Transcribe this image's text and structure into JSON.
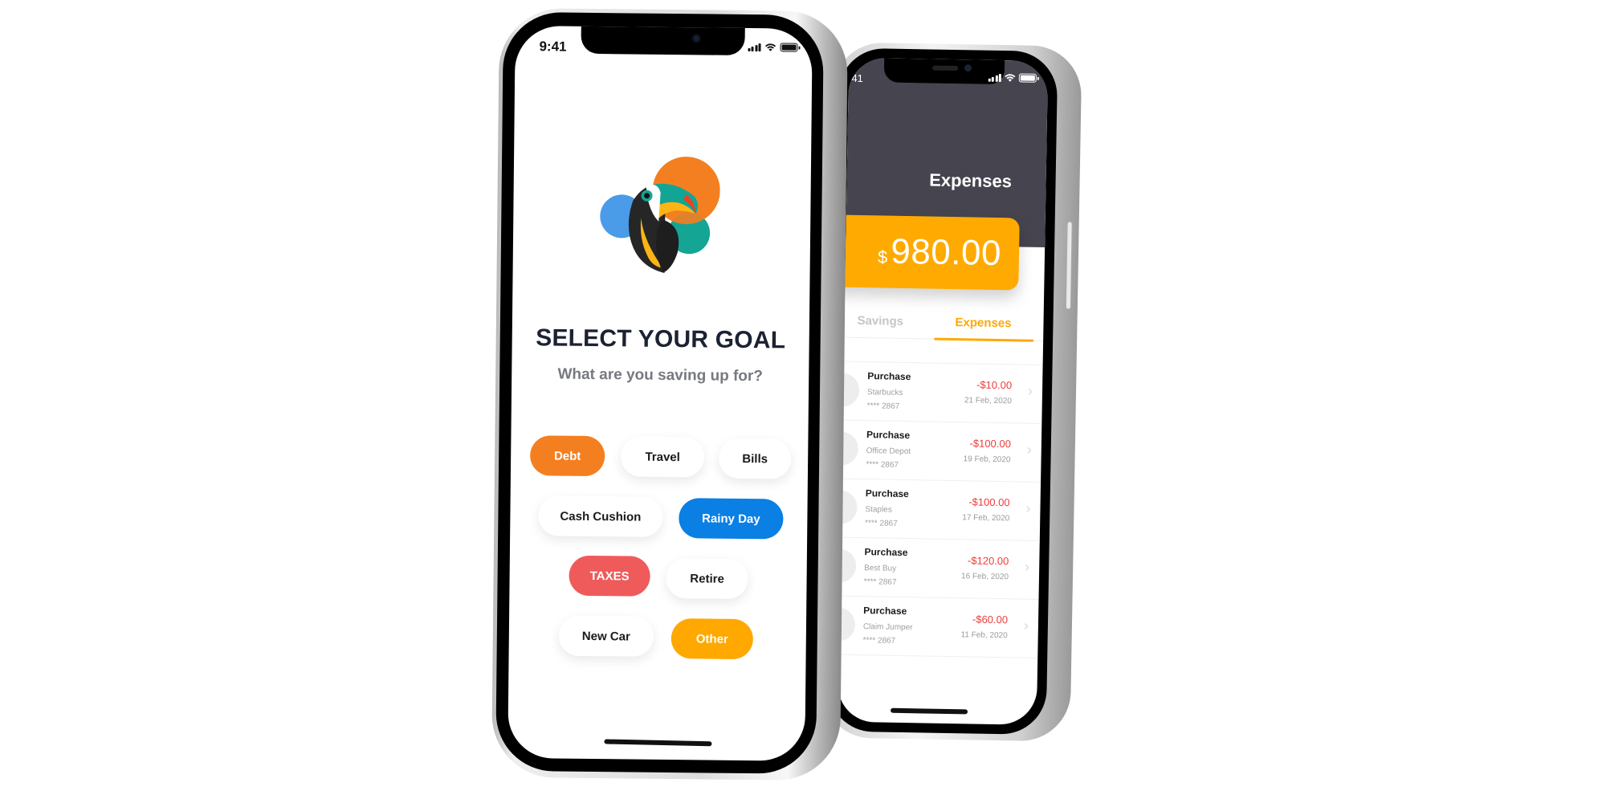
{
  "front_phone": {
    "status_bar": {
      "time": "9:41",
      "icons": [
        "signal-icon",
        "wifi-icon",
        "battery-icon"
      ]
    },
    "logo": "toucan-logo",
    "title": "SELECT YOUR GOAL",
    "subtitle": "What are you saving up for?",
    "goals": [
      {
        "label": "Debt",
        "selected": true,
        "color": "#f47f20"
      },
      {
        "label": "Travel",
        "selected": false
      },
      {
        "label": "Bills",
        "selected": false
      },
      {
        "label": "Cash Cushion",
        "selected": false
      },
      {
        "label": "Rainy Day",
        "selected": true,
        "color": "#0a7fe4"
      },
      {
        "label": "TAXES",
        "selected": true,
        "color": "#ef5b5b"
      },
      {
        "label": "Retire",
        "selected": false
      },
      {
        "label": "New Car",
        "selected": false
      },
      {
        "label": "Other",
        "selected": true,
        "color": "#ffa800"
      }
    ]
  },
  "back_phone": {
    "status_bar": {
      "time": ":41",
      "icons": [
        "signal-icon",
        "wifi-icon",
        "battery-icon"
      ]
    },
    "title": "Expenses",
    "balance": {
      "currency": "$",
      "amount": "980.00"
    },
    "tabs": [
      {
        "label": "Savings",
        "active": false
      },
      {
        "label": "Expenses",
        "active": true
      }
    ],
    "transactions": [
      {
        "type": "Purchase",
        "merchant": "Starbucks",
        "card": "**** 2867",
        "amount": "-$10.00",
        "date": "21 Feb, 2020"
      },
      {
        "type": "Purchase",
        "merchant": "Office Depot",
        "card": "**** 2867",
        "amount": "-$100.00",
        "date": "19 Feb, 2020"
      },
      {
        "type": "Purchase",
        "merchant": "Staples",
        "card": "**** 2867",
        "amount": "-$100.00",
        "date": "17 Feb, 2020"
      },
      {
        "type": "Purchase",
        "merchant": "Best Buy",
        "card": "**** 2867",
        "amount": "-$120.00",
        "date": "16 Feb, 2020"
      },
      {
        "type": "Purchase",
        "merchant": "Claim Jumper",
        "card": "**** 2867",
        "amount": "-$60.00",
        "date": "11 Feb, 2020"
      }
    ]
  },
  "colors": {
    "header_dark": "#45444f",
    "accent_orange": "#ffa800",
    "negative_red": "#ef3b3b",
    "title_navy": "#1c2233"
  }
}
